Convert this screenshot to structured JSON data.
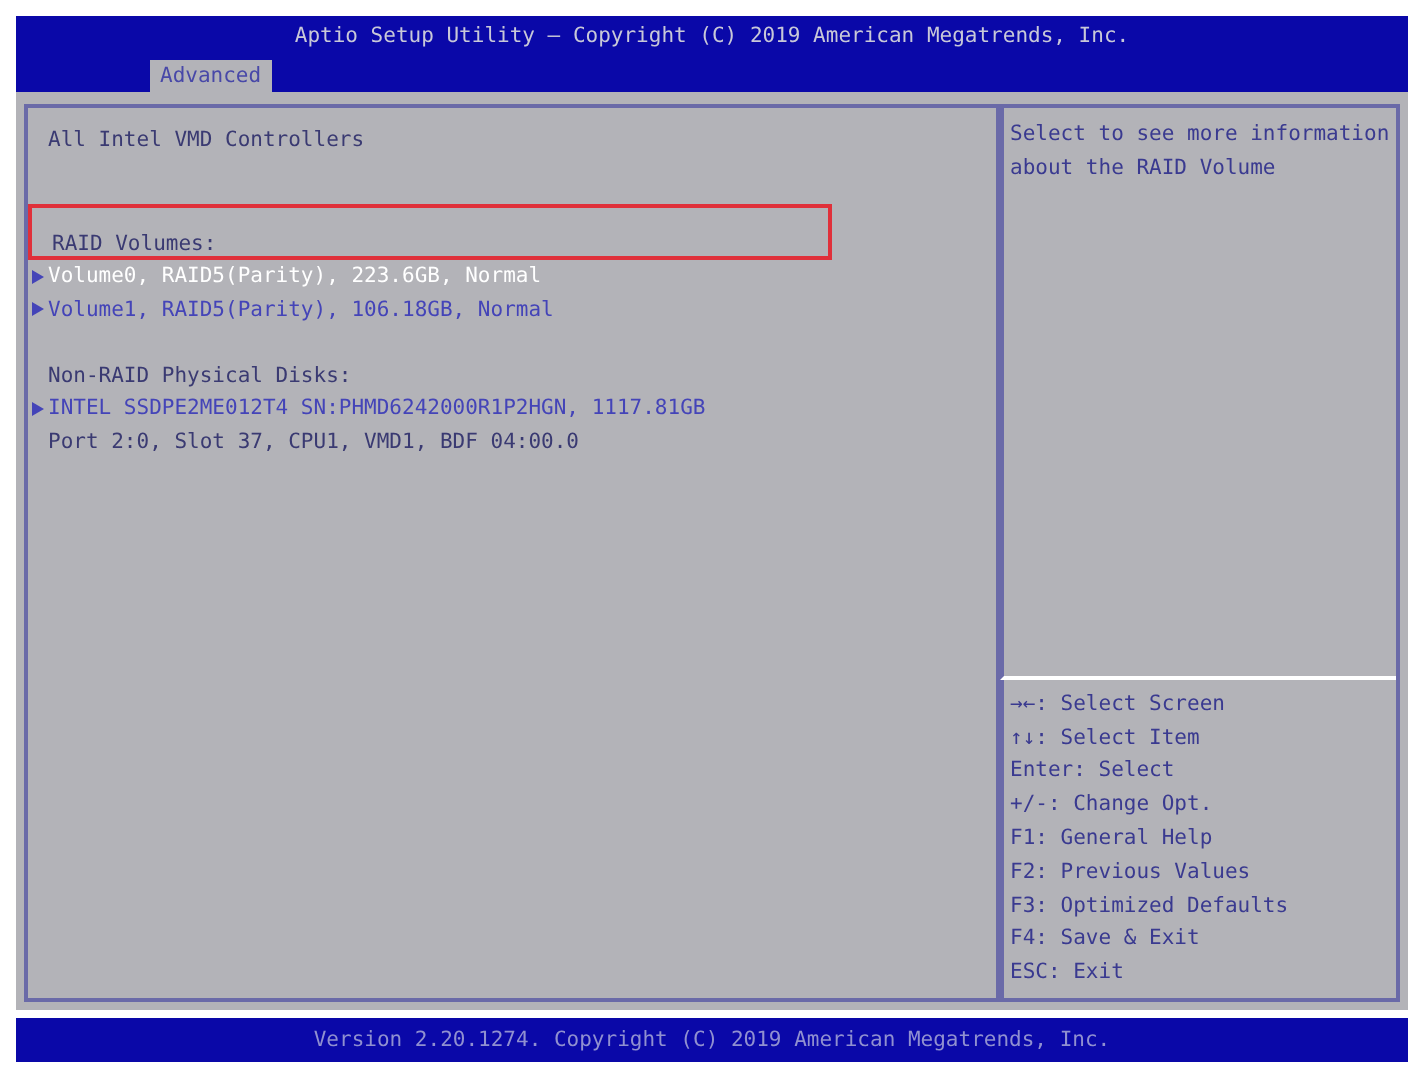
{
  "header": {
    "title": "Aptio Setup Utility – Copyright (C) 2019 American Megatrends, Inc.",
    "tabs": [
      {
        "label": "Advanced",
        "selected": true
      }
    ]
  },
  "items": [
    {
      "kind": "text",
      "label": "All Intel VMD Controllers"
    },
    {
      "kind": "blank"
    },
    {
      "kind": "blank"
    },
    {
      "kind": "text",
      "label": "RAID Volumes:",
      "highlighted": true
    },
    {
      "kind": "link",
      "label": "Volume0, RAID5(Parity), 223.6GB, Normal",
      "selected": true
    },
    {
      "kind": "link",
      "label": "Volume1, RAID5(Parity), 106.18GB, Normal",
      "selected": false
    },
    {
      "kind": "blank"
    },
    {
      "kind": "text",
      "label": "Non-RAID Physical Disks:"
    },
    {
      "kind": "link",
      "label": "INTEL SSDPE2ME012T4 SN:PHMD6242000R1P2HGN, 1117.81GB",
      "selected": false
    },
    {
      "kind": "text",
      "label": "Port  2:0, Slot  37, CPU1, VMD1, BDF 04:00.0"
    }
  ],
  "help": "Select to see more information about the RAID Volume",
  "keys": [
    "→←: Select Screen",
    "↑↓: Select Item",
    "Enter: Select",
    "+/-: Change Opt.",
    "F1: General Help",
    "F2: Previous Values",
    "F3: Optimized Defaults",
    "F4: Save & Exit",
    "ESC: Exit"
  ],
  "footer": "Version 2.20.1274. Copyright (C) 2019 American Megatrends, Inc."
}
